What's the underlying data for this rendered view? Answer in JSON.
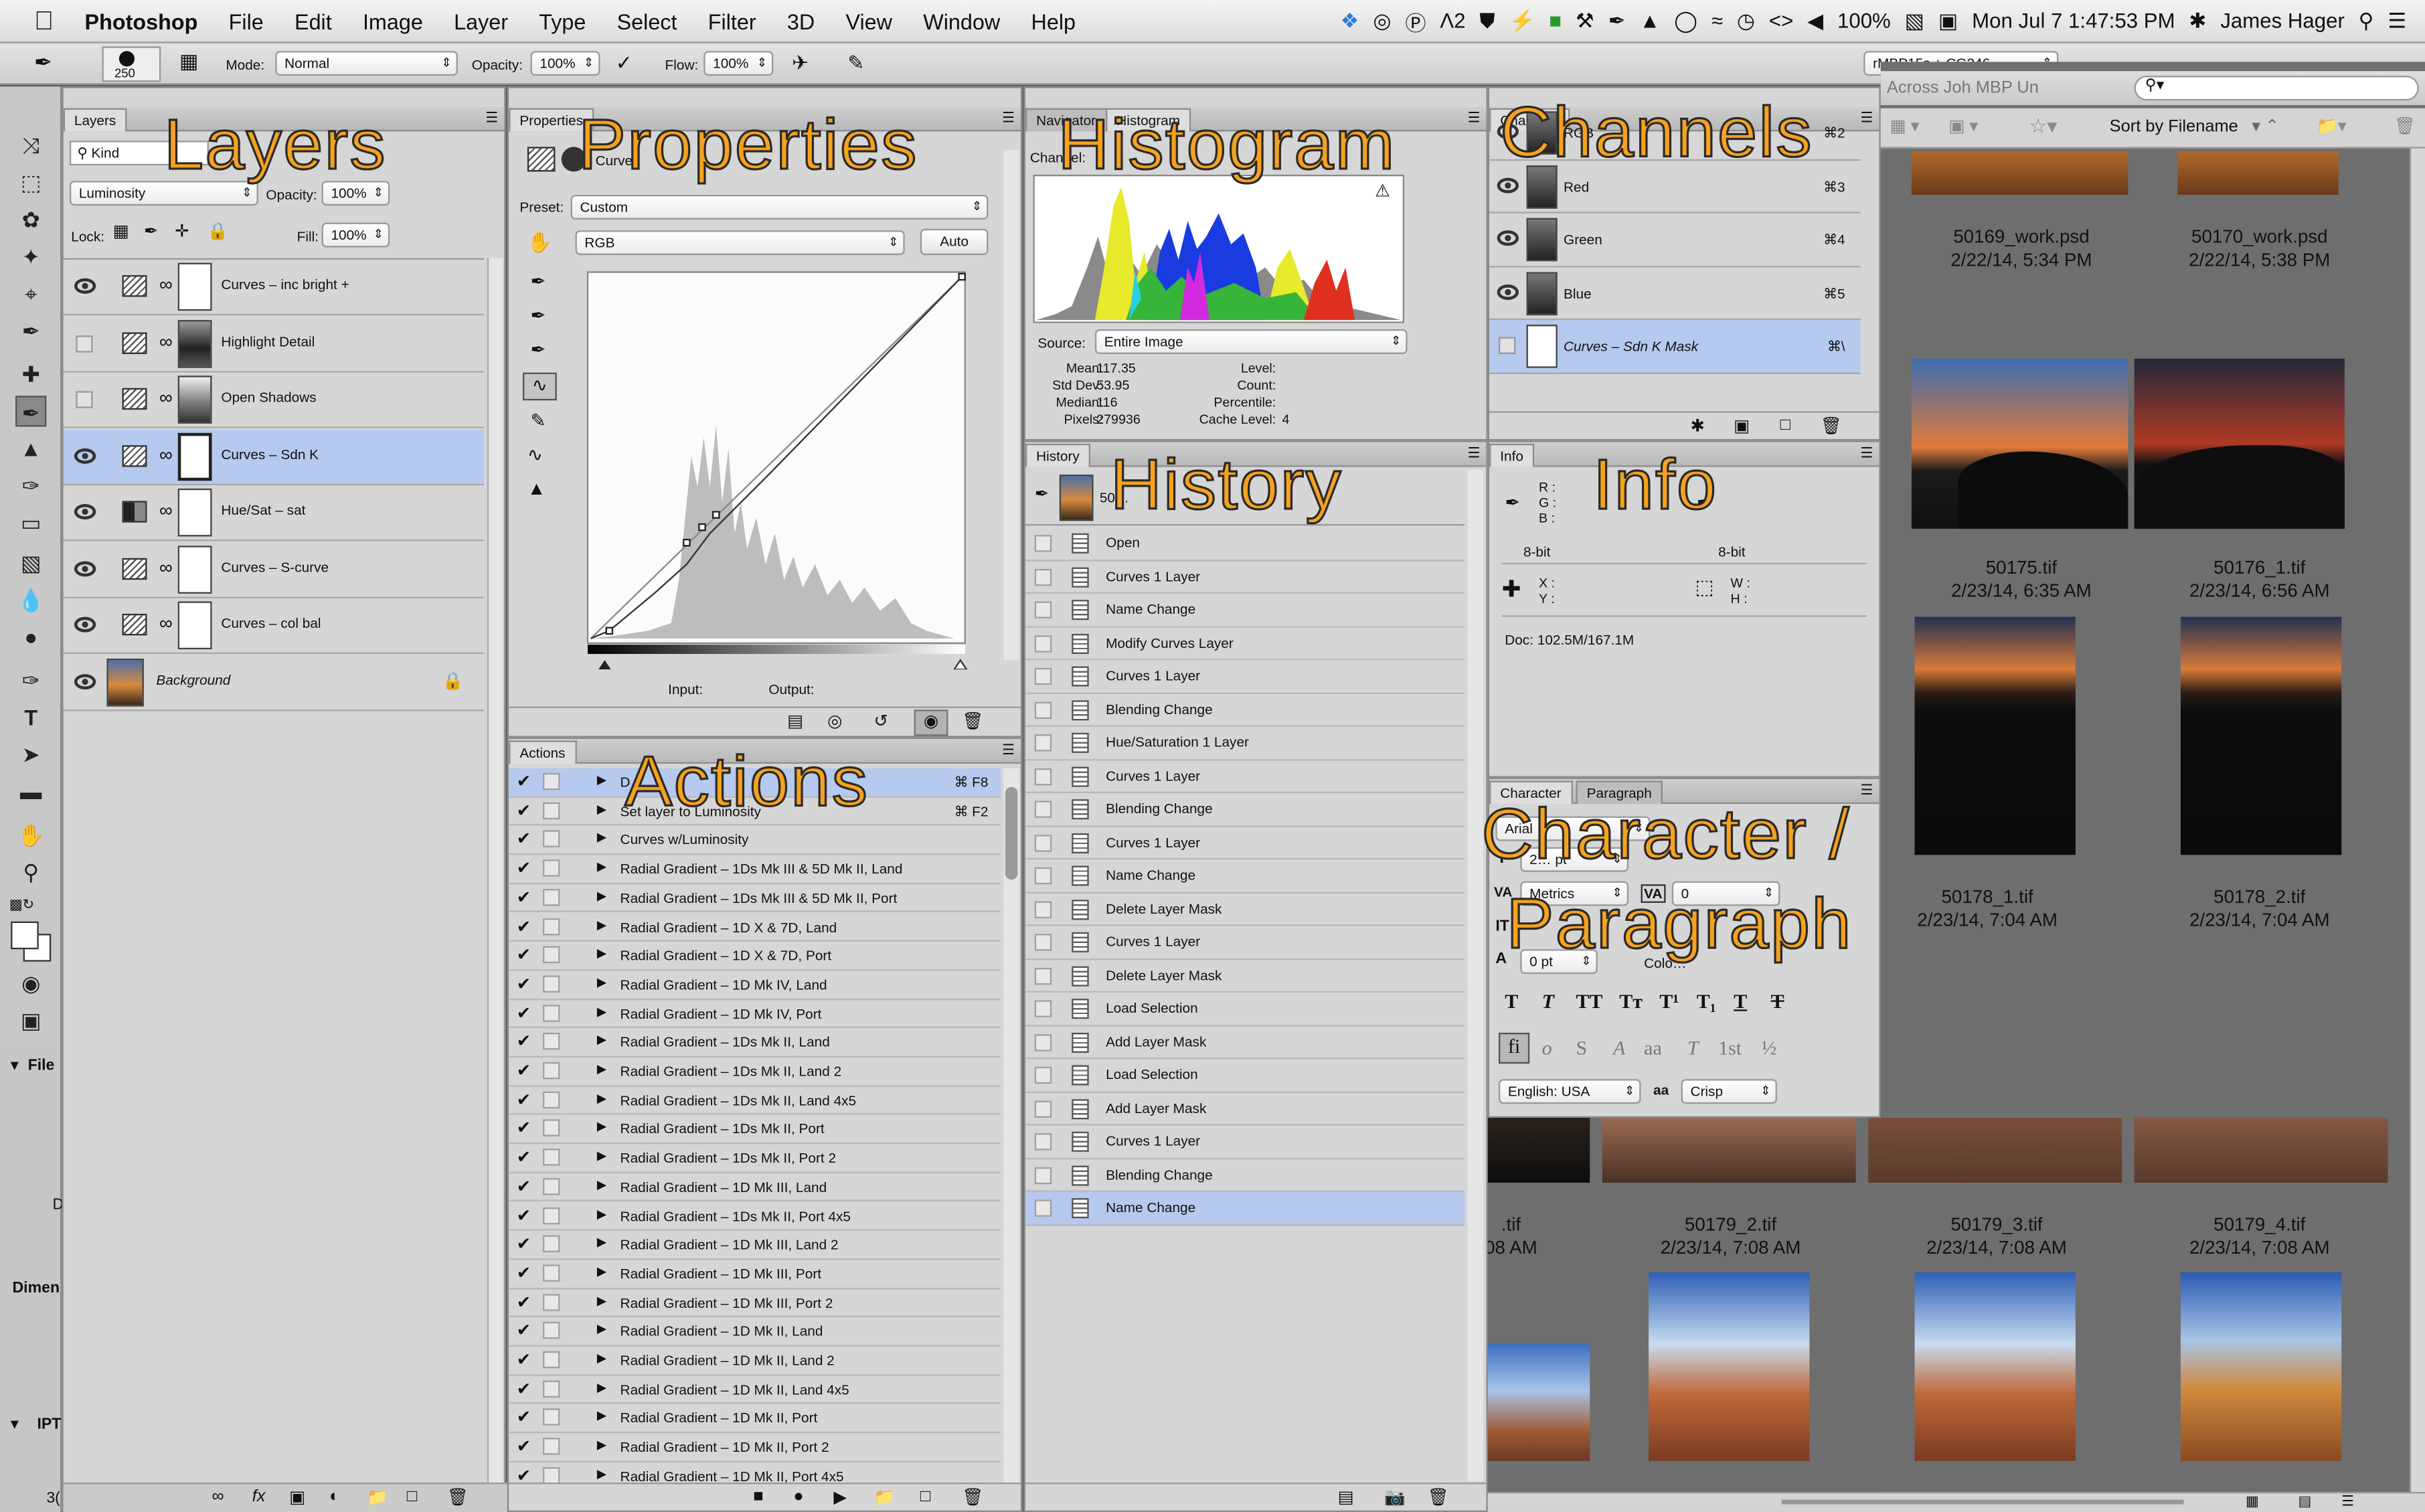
{
  "menubar": {
    "app": "Photoshop",
    "items": [
      "File",
      "Edit",
      "Image",
      "Layer",
      "Type",
      "Select",
      "Filter",
      "3D",
      "View",
      "Window",
      "Help"
    ],
    "tray_num": "2",
    "battery": "100%",
    "clock": "Mon Jul 7  1:47:53 PM",
    "user": "James Hager"
  },
  "options": {
    "brush_size": "250",
    "mode_label": "Mode:",
    "mode": "Normal",
    "opacity_label": "Opacity:",
    "opacity": "100%",
    "flow_label": "Flow:",
    "flow": "100%",
    "profile": "rMBP15s + CG246"
  },
  "overlays": {
    "layers": "Layers",
    "properties": "Properties",
    "histogram": "Histogram",
    "channels": "Channels",
    "history": "History",
    "info": "Info",
    "actions": "Actions",
    "character_1": "Character /",
    "character_2": "Paragraph"
  },
  "layers": {
    "tab": "Layers",
    "filter": "Kind",
    "blend": "Luminosity",
    "opacity_label": "Opacity:",
    "opacity": "100%",
    "lock_label": "Lock:",
    "fill_label": "Fill:",
    "fill": "100%",
    "rows": [
      {
        "name": "Curves – inc bright +"
      },
      {
        "name": "Highlight Detail"
      },
      {
        "name": "Open Shadows"
      },
      {
        "name": "Curves – Sdn K"
      },
      {
        "name": "Hue/Sat – sat"
      },
      {
        "name": "Curves – S-curve"
      },
      {
        "name": "Curves – col bal"
      },
      {
        "name": "Background"
      }
    ]
  },
  "properties": {
    "tab": "Properties",
    "title": "Curves",
    "preset_label": "Preset:",
    "preset": "Custom",
    "channel": "RGB",
    "auto": "Auto",
    "input_label": "Input:",
    "output_label": "Output:"
  },
  "histogram": {
    "tabs": [
      "Navigator",
      "Histogram"
    ],
    "channel_label": "Channel:",
    "source_label": "Source:",
    "source": "Entire Image",
    "mean_label": "Mean:",
    "mean": "117.35",
    "std_label": "Std Dev:",
    "std": "53.95",
    "median_label": "Median:",
    "median": "116",
    "pixels_label": "Pixels:",
    "pixels": "279936",
    "level_label": "Level:",
    "count_label": "Count:",
    "percentile_label": "Percentile:",
    "cache_label": "Cache Level:",
    "cache": "4"
  },
  "channels": {
    "tab": "Channels",
    "rows": [
      {
        "name": "RGB",
        "key": "⌘2"
      },
      {
        "name": "Red",
        "key": "⌘3"
      },
      {
        "name": "Green",
        "key": "⌘4"
      },
      {
        "name": "Blue",
        "key": "⌘5"
      },
      {
        "name": "Curves – Sdn K Mask",
        "key": "⌘\\"
      }
    ]
  },
  "history": {
    "tab": "History",
    "snapshot": "50…",
    "rows": [
      "Open",
      "Curves 1 Layer",
      "Name Change",
      "Modify Curves Layer",
      "Curves 1 Layer",
      "Blending Change",
      "Hue/Saturation 1 Layer",
      "Curves 1 Layer",
      "Blending Change",
      "Curves 1 Layer",
      "Name Change",
      "Delete Layer Mask",
      "Curves 1 Layer",
      "Delete Layer Mask",
      "Load Selection",
      "Add Layer Mask",
      "Load Selection",
      "Add Layer Mask",
      "Curves 1 Layer",
      "Blending Change",
      "Name Change"
    ]
  },
  "info": {
    "tab": "Info",
    "r": "R :",
    "g": "G :",
    "b": "B :",
    "bit1": "8-bit",
    "bit2": "8-bit",
    "x": "X :",
    "y": "Y :",
    "w": "W :",
    "h": "H :",
    "doc": "Doc: 102.5M/167.1M"
  },
  "actions": {
    "tab": "Actions",
    "rows": [
      {
        "name": "D…",
        "key": "⌘ F8"
      },
      {
        "name": "Set layer to Luminosity",
        "key": "⌘ F2"
      },
      {
        "name": "Curves w/Luminosity",
        "key": ""
      },
      {
        "name": "Radial Gradient – 1Ds Mk III & 5D Mk II, Land",
        "key": ""
      },
      {
        "name": "Radial Gradient – 1Ds Mk III & 5D Mk II, Port",
        "key": ""
      },
      {
        "name": "Radial Gradient – 1D X & 7D, Land",
        "key": ""
      },
      {
        "name": "Radial Gradient – 1D X  & 7D, Port",
        "key": ""
      },
      {
        "name": "Radial Gradient – 1D Mk IV, Land",
        "key": ""
      },
      {
        "name": "Radial Gradient – 1D Mk IV, Port",
        "key": ""
      },
      {
        "name": "Radial Gradient – 1Ds Mk II, Land",
        "key": ""
      },
      {
        "name": "Radial Gradient – 1Ds Mk II, Land 2",
        "key": ""
      },
      {
        "name": "Radial Gradient – 1Ds Mk II, Land 4x5",
        "key": ""
      },
      {
        "name": "Radial Gradient – 1Ds Mk II, Port",
        "key": ""
      },
      {
        "name": "Radial Gradient – 1Ds Mk II, Port 2",
        "key": ""
      },
      {
        "name": "Radial Gradient – 1D Mk III, Land",
        "key": ""
      },
      {
        "name": "Radial Gradient – 1Ds Mk II, Port 4x5",
        "key": ""
      },
      {
        "name": "Radial Gradient – 1D Mk III, Land 2",
        "key": ""
      },
      {
        "name": "Radial Gradient – 1D Mk III, Port",
        "key": ""
      },
      {
        "name": "Radial Gradient – 1D Mk III, Port 2",
        "key": ""
      },
      {
        "name": "Radial Gradient – 1D Mk II, Land",
        "key": ""
      },
      {
        "name": "Radial Gradient – 1D Mk II, Land 2",
        "key": ""
      },
      {
        "name": "Radial Gradient – 1D Mk II, Land 4x5",
        "key": ""
      },
      {
        "name": "Radial Gradient – 1D Mk II, Port",
        "key": ""
      },
      {
        "name": "Radial Gradient – 1D Mk II, Port 2",
        "key": ""
      },
      {
        "name": "Radial Gradient – 1D Mk II, Port 4x5",
        "key": ""
      }
    ]
  },
  "character": {
    "tabs": [
      "Character",
      "Paragraph"
    ],
    "font": "Arial",
    "size": "2… pt",
    "tracking": "Metrics",
    "kerning": "0",
    "pt": "0 pt",
    "color_label": "Colo…",
    "language": "English: USA",
    "aa_label": "aa",
    "aa": "Crisp"
  },
  "bridge": {
    "toolbar": "Across  Joh MBP Un",
    "sort": "Sort by Filename",
    "row1": [
      {
        "name": "50169_work.psd",
        "date": "2/22/14, 5:34 PM"
      },
      {
        "name": "50170_work.psd",
        "date": "2/22/14, 5:38 PM"
      }
    ],
    "row2": [
      {
        "name": "50175.tif",
        "date": "2/23/14, 6:35 AM"
      },
      {
        "name": "50176_1.tif",
        "date": "2/23/14, 6:56 AM"
      }
    ],
    "row3": [
      {
        "name": "50178_1.tif",
        "date": "2/23/14, 7:04 AM"
      },
      {
        "name": "50178_2.tif",
        "date": "2/23/14, 7:04 AM"
      }
    ],
    "row4": [
      {
        "name": ".tif",
        "date": "08 AM"
      },
      {
        "name": "50179_2.tif",
        "date": "2/23/14, 7:08 AM"
      },
      {
        "name": "50179_3.tif",
        "date": "2/23/14, 7:08 AM"
      },
      {
        "name": "50179_4.tif",
        "date": "2/23/14, 7:08 AM"
      }
    ],
    "left_labels": [
      "File",
      "D",
      "Dimen",
      "IPT",
      "3("
    ]
  }
}
